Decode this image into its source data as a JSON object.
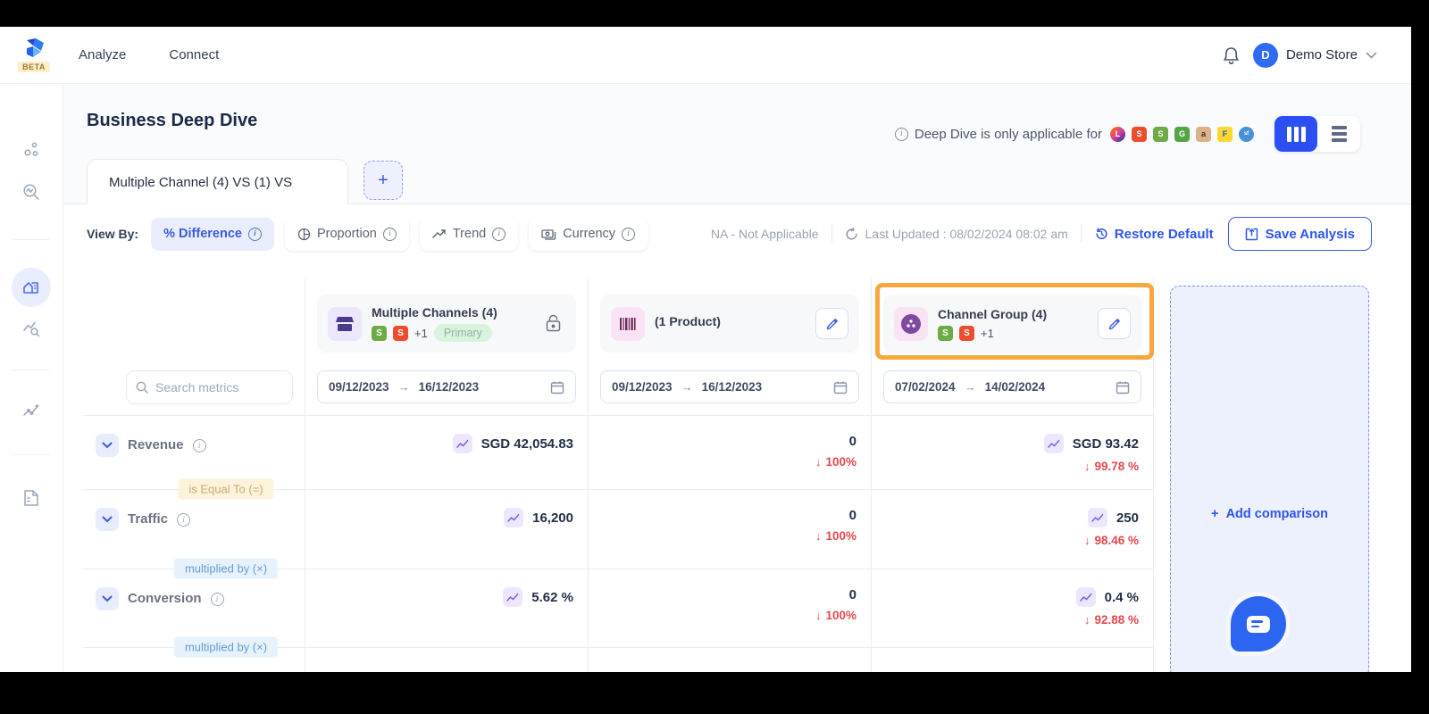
{
  "icons": {
    "down_arrow": "↓",
    "arrow_right": "→",
    "plus": "+"
  },
  "colors": {
    "accent_blue": "#2f54eb",
    "active_pill_bg": "#e9edfc",
    "highlight_orange": "#f8a73f",
    "negative_red": "#e5484d",
    "primary_badge_green": "#d9f3de",
    "spark_purple": "#7c5cf0"
  },
  "navbar": {
    "beta": "BETA",
    "links": [
      "Analyze",
      "Connect"
    ],
    "avatar_letter": "D",
    "store": "Demo Store"
  },
  "page": {
    "title": "Business Deep Dive",
    "note": "Deep Dive is only applicable for",
    "platform_icons": [
      "lazada",
      "shopee",
      "shopify",
      "grabmart",
      "amazon",
      "flipkart",
      "salesforce"
    ]
  },
  "tabs": {
    "active": "Multiple Channel (4) VS (1) VS"
  },
  "viewbar": {
    "label": "View By:",
    "options": [
      "% Difference",
      "Proportion",
      "Trend",
      "Currency"
    ],
    "na_note": "NA - Not Applicable",
    "last_updated": "Last Updated : 08/02/2024 08:02 am",
    "restore": "Restore Default",
    "save": "Save Analysis"
  },
  "table": {
    "search_placeholder": "Search metrics",
    "columns": [
      {
        "title": "Multiple Channels (4)",
        "extra": "+1",
        "badge": "Primary",
        "locked": true,
        "date_from": "09/12/2023",
        "date_to": "16/12/2023"
      },
      {
        "title": "(1 Product)",
        "editable": true,
        "date_from": "09/12/2023",
        "date_to": "16/12/2023"
      },
      {
        "title": "Channel Group (4)",
        "extra": "+1",
        "editable": true,
        "highlighted": true,
        "date_from": "07/02/2024",
        "date_to": "14/02/2024"
      }
    ],
    "rows": [
      {
        "metric": "Revenue",
        "c1": "SGD 42,054.83",
        "c2": "0",
        "c2_diff": "100%",
        "c3": "SGD 93.42",
        "c3_diff": "99.78 %",
        "connector_below": "is Equal To (=)"
      },
      {
        "metric": "Traffic",
        "c1": "16,200",
        "c2": "0",
        "c2_diff": "100%",
        "c3": "250",
        "c3_diff": "98.46 %",
        "connector_below": "multiplied by (×)"
      },
      {
        "metric": "Conversion",
        "c1": "5.62 %",
        "c2": "0",
        "c2_diff": "100%",
        "c3": "0.4 %",
        "c3_diff": "92.88 %",
        "connector_below": "multiplied by (×)"
      }
    ],
    "add_comparison": "Add comparison"
  }
}
